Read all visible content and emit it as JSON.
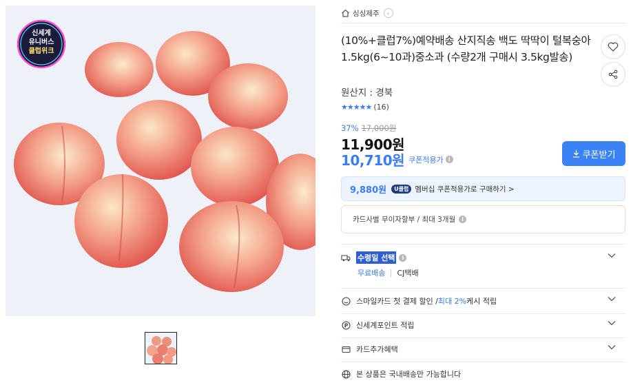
{
  "images": {
    "main_alt": "peaches",
    "badge_lines": [
      "신세계",
      "유니버스",
      "클럽위크"
    ]
  },
  "store": {
    "name": "싱싱제주"
  },
  "product": {
    "title": "(10%+클럽7%)예약배송 산지직송 백도 딱딱이 털복숭아 1.5kg(6~10과)중소과 (수량2개 구매시 3.5kg발송)",
    "origin": "원산지 : 경북",
    "rating_stars": "★★★★★",
    "review_count": "(16)"
  },
  "pricing": {
    "discount_rate": "37%",
    "original_price": "17,000원",
    "sale_price": "11,900원",
    "coupon_price": "10,710원",
    "coupon_price_label": "쿠폰적용가",
    "coupon_button": "쿠폰받기"
  },
  "membership": {
    "price": "9,880원",
    "badge": "U클럽",
    "text": "멤버십 쿠폰적용가로 구매하기 >"
  },
  "card": {
    "text": "카드사별 무이자할부 / 최대 3개월"
  },
  "options": {
    "delivery_date": "수령일 선택",
    "delivery_free": "무료배송",
    "delivery_carrier": "CJ택배",
    "smile_prefix": "스마일카드 첫 결제 할인 / ",
    "smile_highlight": "최대 2%",
    "smile_suffix": " 케시 적립",
    "points": "신세계포인트 적립",
    "card_benefit": "카드추가혜택",
    "domestic": "본 상품은 국내배송만 가능합니다"
  },
  "colors": {
    "accent": "#3a7cf5",
    "highlight": "#2f5dd6",
    "badge_bg": "#1f3b82"
  }
}
